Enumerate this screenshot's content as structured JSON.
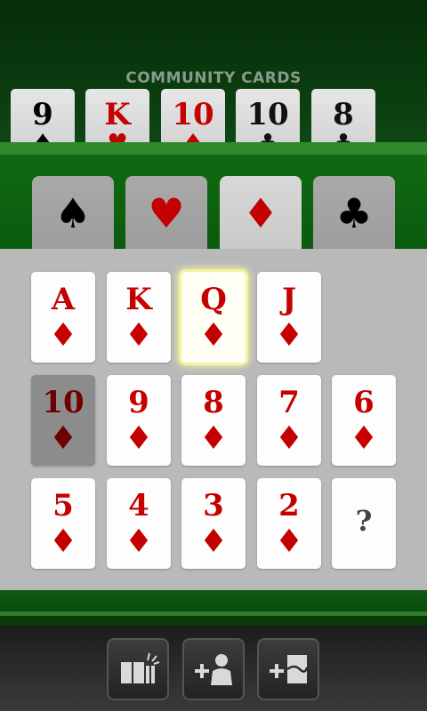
{
  "header": {
    "title": "COMMUNITY CARDS"
  },
  "community_cards": [
    {
      "rank": "9",
      "suit": "♠",
      "color": "black"
    },
    {
      "rank": "K",
      "suit": "♥",
      "color": "red"
    },
    {
      "rank": "10",
      "suit": "♦",
      "color": "red"
    },
    {
      "rank": "10",
      "suit": "♣",
      "color": "black"
    },
    {
      "rank": "8",
      "suit": "♣",
      "color": "black"
    }
  ],
  "suit_tabs": [
    {
      "symbol": "♠",
      "name": "spades",
      "color": "#000000",
      "active": false
    },
    {
      "symbol": "♥",
      "name": "hearts",
      "color": "#c40000",
      "active": false
    },
    {
      "symbol": "♦",
      "name": "diamonds",
      "color": "#c40000",
      "active": true
    },
    {
      "symbol": "♣",
      "name": "clubs",
      "color": "#000000",
      "active": false
    }
  ],
  "picker": {
    "suit_symbol": "♦",
    "cards": [
      {
        "rank": "A",
        "state": "normal"
      },
      {
        "rank": "K",
        "state": "normal"
      },
      {
        "rank": "Q",
        "state": "selected"
      },
      {
        "rank": "J",
        "state": "normal"
      },
      {
        "rank": "10",
        "state": "used"
      },
      {
        "rank": "9",
        "state": "normal"
      },
      {
        "rank": "8",
        "state": "normal"
      },
      {
        "rank": "7",
        "state": "normal"
      },
      {
        "rank": "6",
        "state": "normal"
      },
      {
        "rank": "5",
        "state": "normal"
      },
      {
        "rank": "4",
        "state": "normal"
      },
      {
        "rank": "3",
        "state": "normal"
      },
      {
        "rank": "2",
        "state": "normal"
      }
    ],
    "unknown_label": "?"
  },
  "toolbar": {
    "buttons": [
      {
        "icon": "new-deal-icon"
      },
      {
        "icon": "add-player-icon"
      },
      {
        "icon": "add-card-icon"
      }
    ]
  },
  "colors": {
    "red": "#c40000",
    "black": "#111111",
    "selected_glow": "#f2f59a"
  }
}
